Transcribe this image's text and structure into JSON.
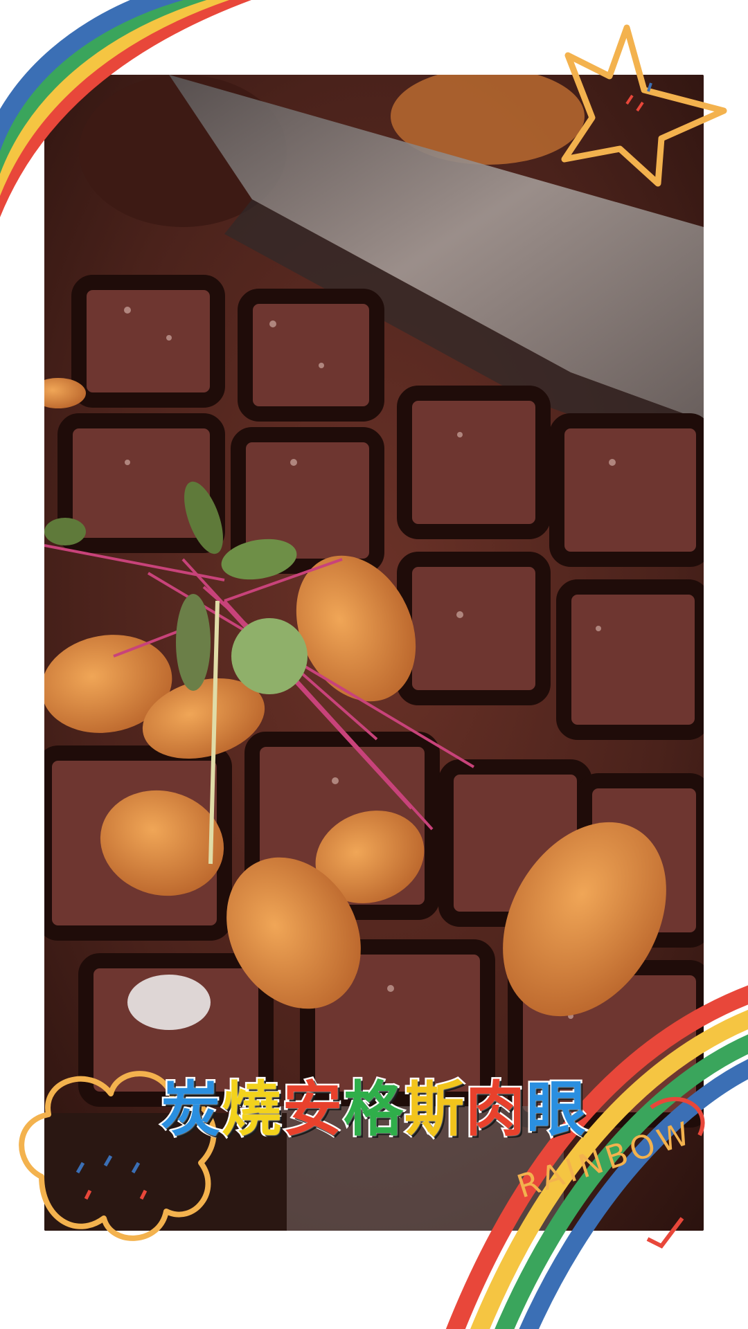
{
  "caption": {
    "chars": [
      {
        "text": "炭",
        "color": "#2a8fe0"
      },
      {
        "text": "燒",
        "color": "#f2d21c"
      },
      {
        "text": "安",
        "color": "#e8412c"
      },
      {
        "text": "格",
        "color": "#2fae4a"
      },
      {
        "text": "斯",
        "color": "#f2c41c"
      },
      {
        "text": "肉",
        "color": "#e8412c"
      },
      {
        "text": "眼",
        "color": "#2a8fe0"
      }
    ]
  },
  "sticker": {
    "rainbow_text": "RAINBOW"
  },
  "colors": {
    "rainbow_red": "#e8473a",
    "rainbow_yellow": "#f5c542",
    "rainbow_green": "#3aa55c",
    "rainbow_blue": "#3b6fb5",
    "doodle_orange": "#f3b24e",
    "steak": "#5a2a22",
    "garlic_chip": "#d9863a"
  },
  "icons": [
    "star-doodle-icon",
    "cloud-doodle-icon",
    "heart-doodle-icon"
  ]
}
